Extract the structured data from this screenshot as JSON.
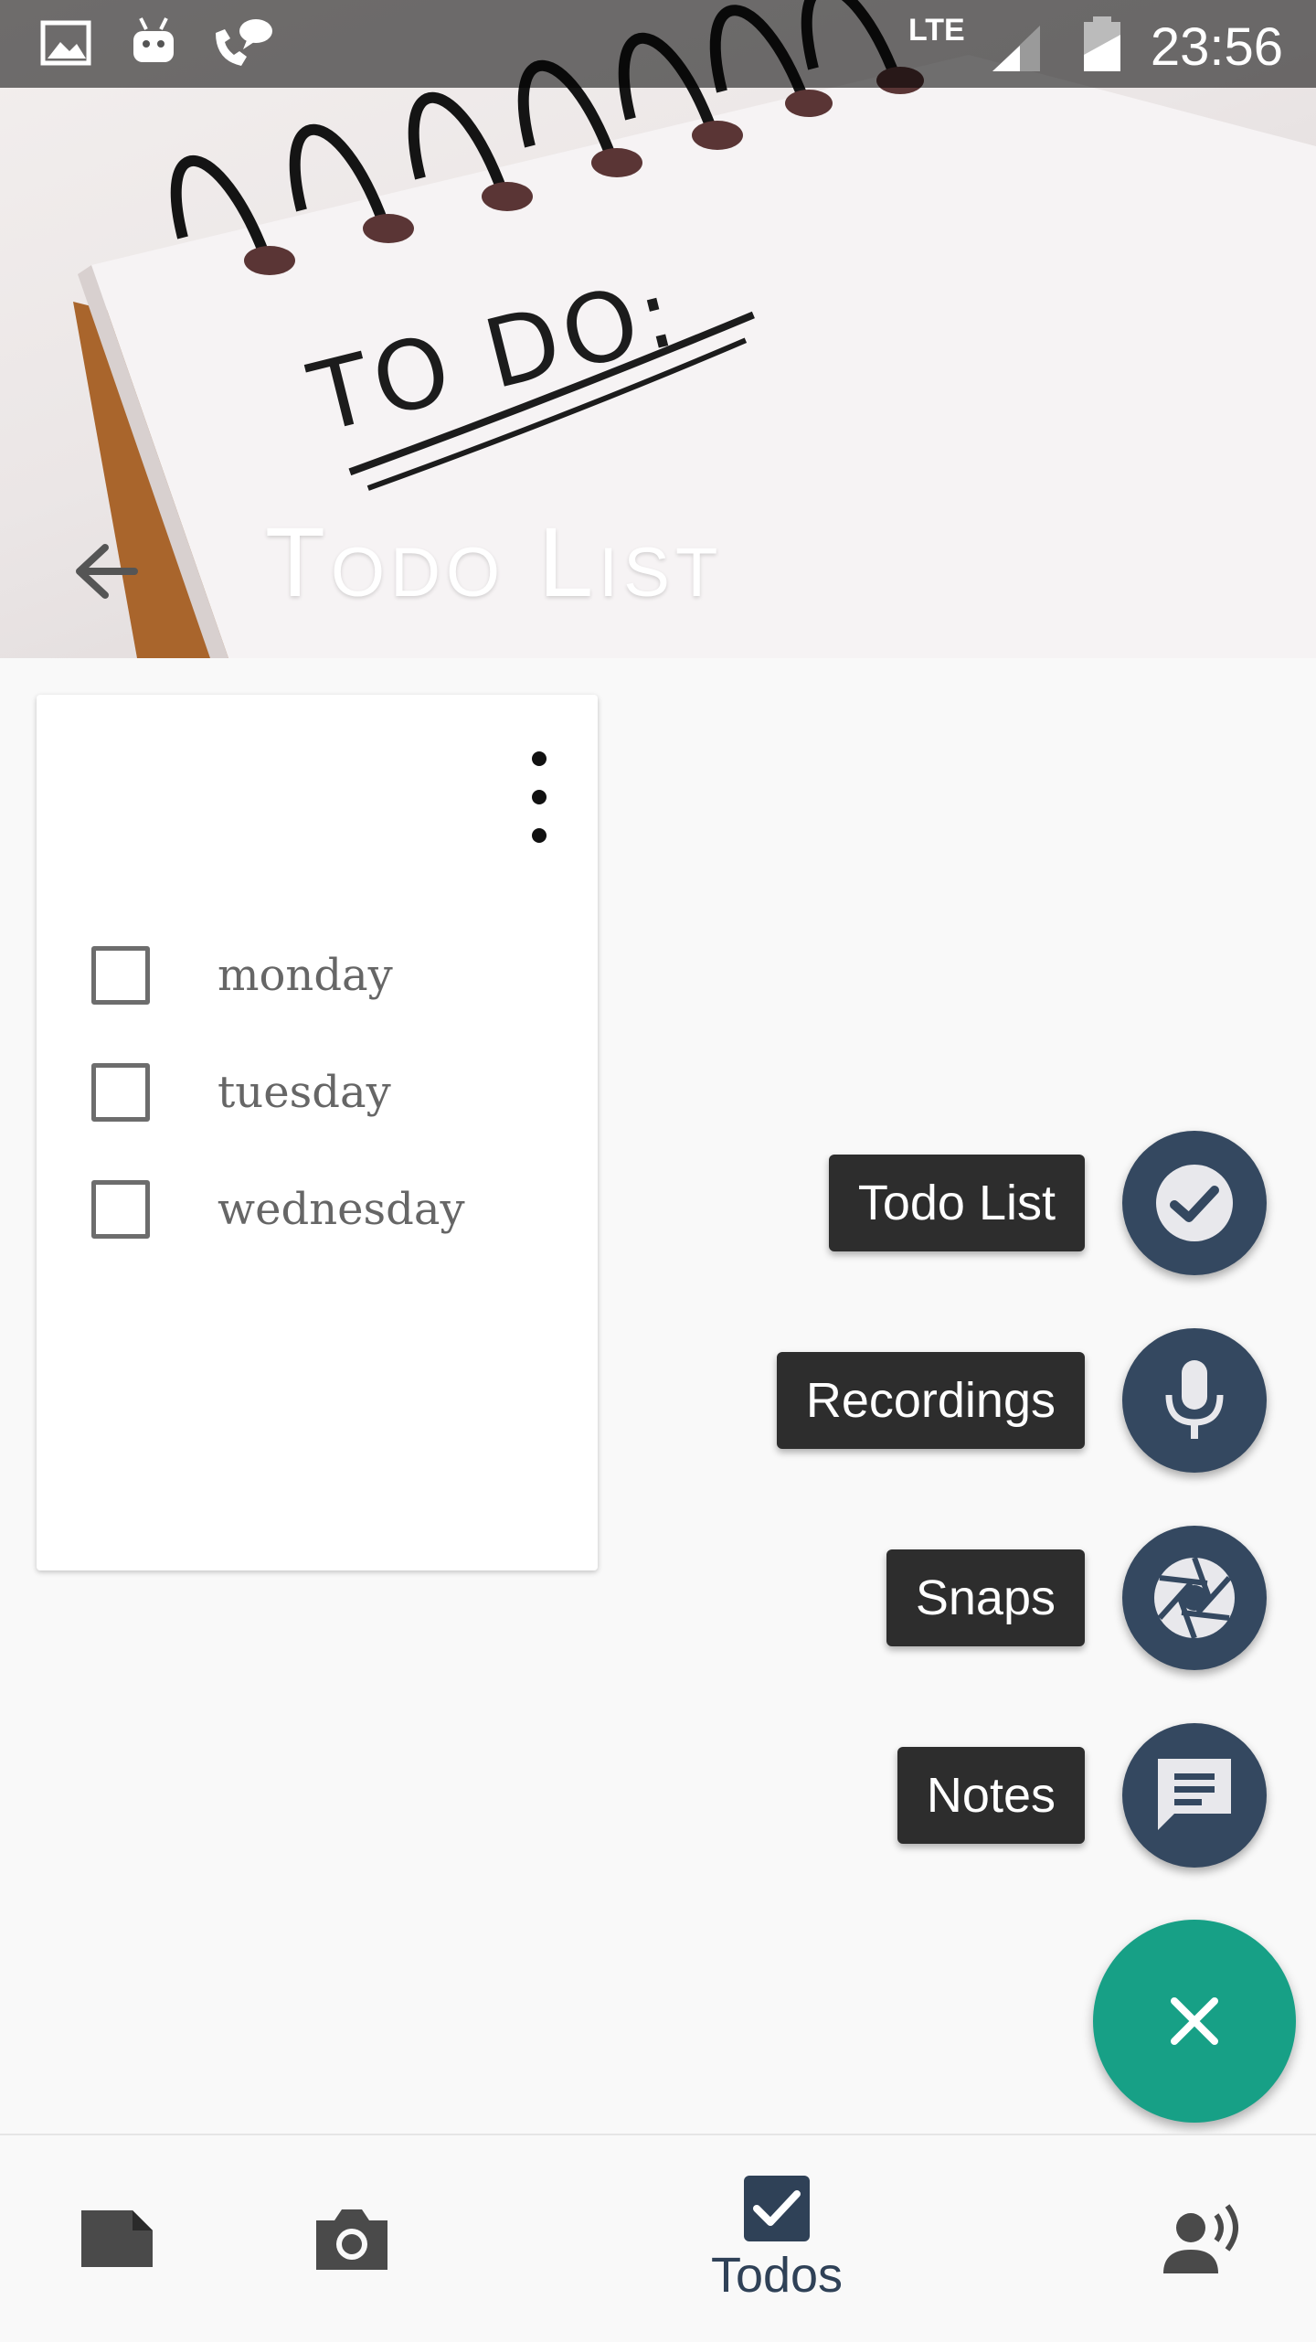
{
  "status_bar": {
    "time": "23:56",
    "network": "LTE",
    "icons": [
      "image-icon",
      "android-icon",
      "call-chat-icon",
      "lte-icon",
      "signal-icon",
      "battery-charging-icon"
    ]
  },
  "header": {
    "title": "Todo List",
    "image_text": "TO DO:",
    "back_icon": "arrow-back-icon"
  },
  "card": {
    "menu_icon": "more-vertical-icon",
    "items": [
      {
        "label": "monday",
        "checked": false
      },
      {
        "label": "tuesday",
        "checked": false
      },
      {
        "label": "wednesday",
        "checked": false
      }
    ]
  },
  "speed_dial": {
    "actions": [
      {
        "label": "Todo List",
        "icon": "check-icon"
      },
      {
        "label": "Recordings",
        "icon": "microphone-icon"
      },
      {
        "label": "Snaps",
        "icon": "camera-shutter-icon"
      },
      {
        "label": "Notes",
        "icon": "note-icon"
      }
    ],
    "main_icon": "close-icon",
    "colors": {
      "mini_fab": "#344860",
      "main_fab": "#17a086",
      "label_bg": "#2d2d2d"
    }
  },
  "bottom_nav": {
    "items": [
      {
        "icon": "note-icon",
        "label": ""
      },
      {
        "icon": "camera-icon",
        "label": ""
      },
      {
        "icon": "checkbox-icon",
        "label": "Todos",
        "active": true
      },
      {
        "icon": "voice-icon",
        "label": ""
      }
    ]
  }
}
